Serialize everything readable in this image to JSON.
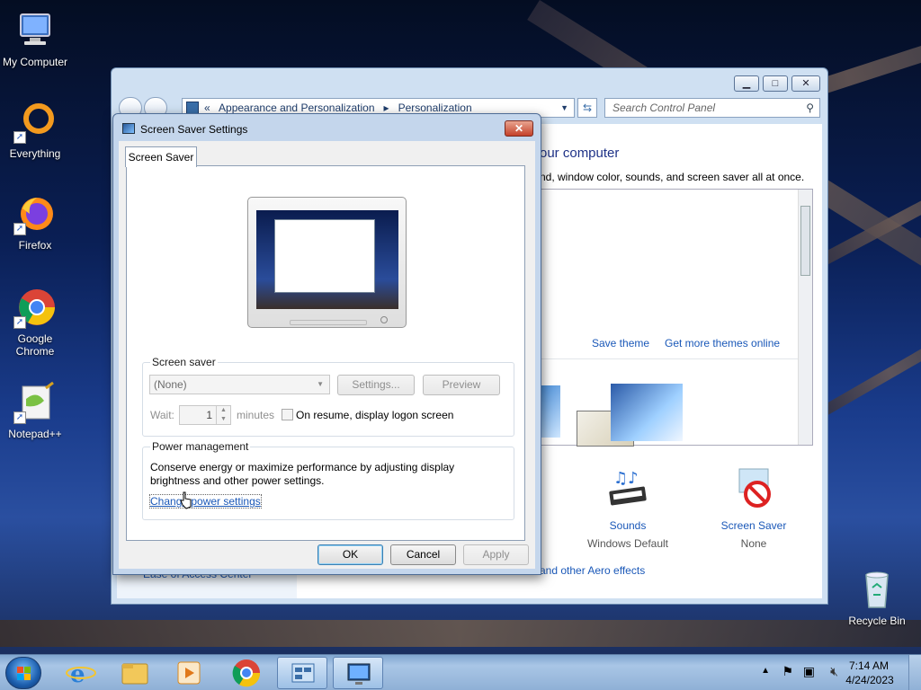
{
  "desktop": {
    "icons": [
      {
        "label": "My Computer"
      },
      {
        "label": "Everything"
      },
      {
        "label": "Firefox"
      },
      {
        "label": "Google Chrome"
      },
      {
        "label": "Notepad++"
      },
      {
        "label": "Recycle Bin"
      }
    ]
  },
  "control_panel": {
    "breadcrumb": {
      "sep": "«",
      "crumb1": "Appearance and Personalization",
      "arrow": "▸",
      "crumb2": "Personalization"
    },
    "search_placeholder": "Search Control Panel",
    "heading_partial": "our computer",
    "subtitle_partial": "nd, window color, sounds, and screen saver all at once.",
    "save_theme": "Save theme",
    "get_more_themes": "Get more themes online",
    "sounds_label": "Sounds",
    "sounds_value": "Windows Default",
    "screen_saver_label": "Screen Saver",
    "screen_saver_value": "None",
    "aero_partial": "and other Aero effects",
    "ease_partial": "Ease of Access Center",
    "buttons": {
      "minimize": "▁",
      "maximize": "□",
      "close": "✕"
    }
  },
  "dialog": {
    "title": "Screen Saver Settings",
    "close": "✕",
    "tab_label": "Screen Saver",
    "screen_saver_group": "Screen saver",
    "screen_saver_selected": "(None)",
    "settings_btn": "Settings...",
    "preview_btn": "Preview",
    "wait_label": "Wait:",
    "wait_value": "1",
    "minutes_label": "minutes",
    "resume_label": "On resume, display logon screen",
    "power_group": "Power management",
    "power_text": "Conserve energy or maximize performance by adjusting display brightness and other power settings.",
    "power_link": "Change power settings",
    "ok": "OK",
    "cancel": "Cancel",
    "apply": "Apply"
  },
  "taskbar": {
    "time": "7:14 AM",
    "date": "4/24/2023"
  },
  "colors": {
    "link": "#1a58b8",
    "taskbar": "#8fb0d6"
  }
}
